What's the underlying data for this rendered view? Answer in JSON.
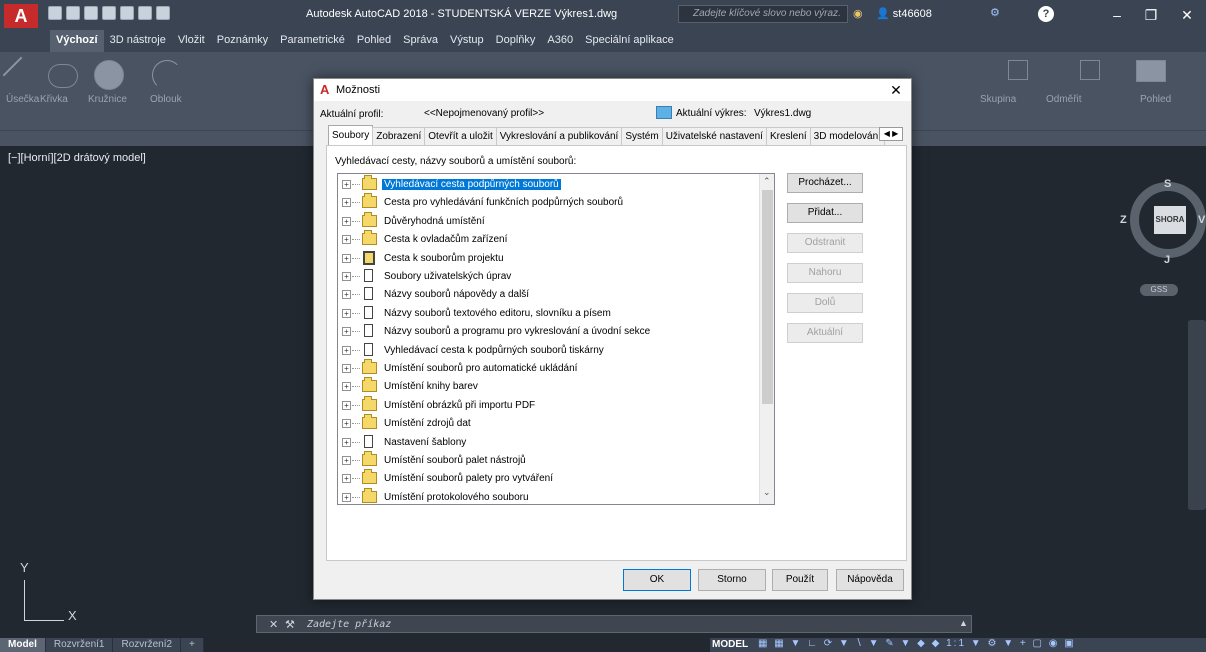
{
  "app": {
    "title": "Autodesk AutoCAD 2018 - STUDENTSKÁ VERZE   Výkres1.dwg",
    "search_placeholder": "Zadejte klíčové slovo nebo výraz.",
    "user": "st46608",
    "logo": "A"
  },
  "ribbon_tabs": [
    "Výchozí",
    "3D nástroje",
    "Vložit",
    "Poznámky",
    "Parametrické",
    "Pohled",
    "Správa",
    "Výstup",
    "Doplňky",
    "A360",
    "Speciální aplikace"
  ],
  "ribbon_labels": [
    "Úsečka",
    "Křivka",
    "Kružnice",
    "Oblouk",
    "Skupina",
    "Odměřit",
    "Pohled"
  ],
  "viewport": {
    "label": "[−][Horní][2D drátový model]",
    "cube": {
      "n": "S",
      "s": "J",
      "e": "V",
      "w": "Z",
      "face": "SHORA",
      "gss": "GSS"
    },
    "ucs_x": "X",
    "ucs_y": "Y"
  },
  "command": {
    "placeholder": "Zadejte příkaz"
  },
  "layout_tabs": [
    "Model",
    "Rozvržení1",
    "Rozvržení2",
    "+"
  ],
  "status": {
    "model": "MODEL",
    "scale": "1:1"
  },
  "dialog": {
    "title": "Možnosti",
    "profile_label": "Aktuální profil:",
    "profile_value": "<<Nepojmenovaný profil>>",
    "drawing_label": "Aktuální výkres:",
    "drawing_value": "Výkres1.dwg",
    "tabs": [
      "Soubory",
      "Zobrazení",
      "Otevřít a uložit",
      "Vykreslování a publikování",
      "Systém",
      "Uživatelské nastavení",
      "Kreslení",
      "3D modelování"
    ],
    "panel_label": "Vyhledávací cesty, názvy souborů a umístění souborů:",
    "tree": [
      {
        "label": "Vyhledávací cesta podpůrných souborů",
        "icon": "folder",
        "selected": true
      },
      {
        "label": "Cesta pro vyhledávání funkčních podpůrných souborů",
        "icon": "folder"
      },
      {
        "label": "Důvěryhodná umístění",
        "icon": "folder"
      },
      {
        "label": "Cesta k ovladačům zařízení",
        "icon": "folder"
      },
      {
        "label": "Cesta k souborům projektu",
        "icon": "project"
      },
      {
        "label": "Soubory uživatelských úprav",
        "icon": "document"
      },
      {
        "label": "Názvy souborů nápovědy a další",
        "icon": "document"
      },
      {
        "label": "Názvy souborů textového editoru, slovníku a písem",
        "icon": "document"
      },
      {
        "label": "Názvy souborů a programu pro vykreslování a úvodní sekce",
        "icon": "document"
      },
      {
        "label": "Vyhledávací cesta k podpůrných souborů tiskárny",
        "icon": "document"
      },
      {
        "label": "Umístění souborů pro automatické ukládání",
        "icon": "folder"
      },
      {
        "label": "Umístění knihy barev",
        "icon": "folder"
      },
      {
        "label": "Umístění obrázků při importu PDF",
        "icon": "folder"
      },
      {
        "label": "Umístění zdrojů dat",
        "icon": "folder"
      },
      {
        "label": "Nastavení šablony",
        "icon": "document"
      },
      {
        "label": "Umístění souborů palet nástrojů",
        "icon": "folder"
      },
      {
        "label": "Umístění souborů palety pro vytváření",
        "icon": "folder"
      },
      {
        "label": "Umístění protokolového souboru",
        "icon": "folder"
      }
    ],
    "side_buttons": [
      {
        "label": "Procházet...",
        "enabled": true
      },
      {
        "label": "Přidat...",
        "enabled": true
      },
      {
        "label": "Odstranit",
        "enabled": false
      },
      {
        "label": "Nahoru",
        "enabled": false
      },
      {
        "label": "Dolů",
        "enabled": false
      },
      {
        "label": "Aktuální",
        "enabled": false
      }
    ],
    "buttons": {
      "ok": "OK",
      "cancel": "Storno",
      "apply": "Použít",
      "help": "Nápověda"
    }
  }
}
